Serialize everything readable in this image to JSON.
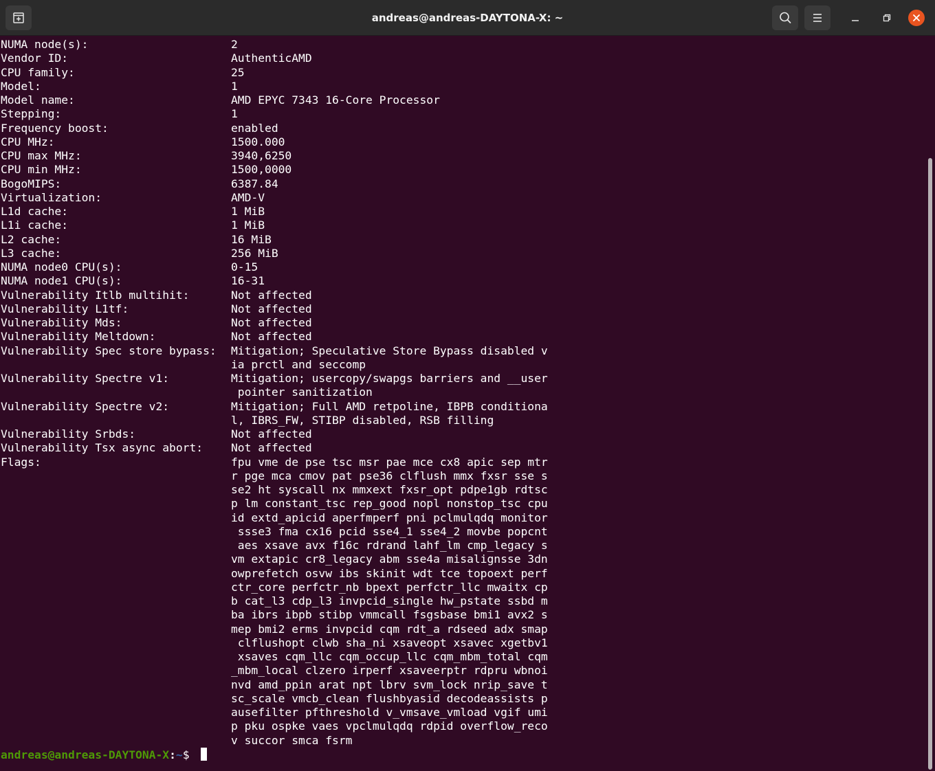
{
  "window": {
    "title": "andreas@andreas-DAYTONA-X: ~"
  },
  "icons": {
    "new_tab": "new-tab-icon",
    "search": "search-icon",
    "menu": "hamburger-menu-icon",
    "minimize": "minimize-icon",
    "maximize": "maximize-icon",
    "close": "close-icon"
  },
  "colors": {
    "terminal_bg": "#300a24",
    "titlebar_bg": "#2b2b2b",
    "close_btn": "#e95420",
    "prompt_user": "#4e9a06",
    "prompt_path": "#3465a4"
  },
  "terminal": {
    "lines": [
      {
        "label": "NUMA node(s):",
        "value": "2"
      },
      {
        "label": "Vendor ID:",
        "value": "AuthenticAMD"
      },
      {
        "label": "CPU family:",
        "value": "25"
      },
      {
        "label": "Model:",
        "value": "1"
      },
      {
        "label": "Model name:",
        "value": "AMD EPYC 7343 16-Core Processor"
      },
      {
        "label": "Stepping:",
        "value": "1"
      },
      {
        "label": "Frequency boost:",
        "value": "enabled"
      },
      {
        "label": "CPU MHz:",
        "value": "1500.000"
      },
      {
        "label": "CPU max MHz:",
        "value": "3940,6250"
      },
      {
        "label": "CPU min MHz:",
        "value": "1500,0000"
      },
      {
        "label": "BogoMIPS:",
        "value": "6387.84"
      },
      {
        "label": "Virtualization:",
        "value": "AMD-V"
      },
      {
        "label": "L1d cache:",
        "value": "1 MiB"
      },
      {
        "label": "L1i cache:",
        "value": "1 MiB"
      },
      {
        "label": "L2 cache:",
        "value": "16 MiB"
      },
      {
        "label": "L3 cache:",
        "value": "256 MiB"
      },
      {
        "label": "NUMA node0 CPU(s):",
        "value": "0-15"
      },
      {
        "label": "NUMA node1 CPU(s):",
        "value": "16-31"
      },
      {
        "label": "Vulnerability Itlb multihit:",
        "value": "Not affected"
      },
      {
        "label": "Vulnerability L1tf:",
        "value": "Not affected"
      },
      {
        "label": "Vulnerability Mds:",
        "value": "Not affected"
      },
      {
        "label": "Vulnerability Meltdown:",
        "value": "Not affected"
      },
      {
        "label": "Vulnerability Spec store bypass:",
        "value": "Mitigation; Speculative Store Bypass disabled v"
      },
      {
        "label": "",
        "value": "ia prctl and seccomp"
      },
      {
        "label": "Vulnerability Spectre v1:",
        "value": "Mitigation; usercopy/swapgs barriers and __user"
      },
      {
        "label": "",
        "value": " pointer sanitization"
      },
      {
        "label": "Vulnerability Spectre v2:",
        "value": "Mitigation; Full AMD retpoline, IBPB conditiona"
      },
      {
        "label": "",
        "value": "l, IBRS_FW, STIBP disabled, RSB filling"
      },
      {
        "label": "Vulnerability Srbds:",
        "value": "Not affected"
      },
      {
        "label": "Vulnerability Tsx async abort:",
        "value": "Not affected"
      },
      {
        "label": "Flags:",
        "value": "fpu vme de pse tsc msr pae mce cx8 apic sep mtr"
      },
      {
        "label": "",
        "value": "r pge mca cmov pat pse36 clflush mmx fxsr sse s"
      },
      {
        "label": "",
        "value": "se2 ht syscall nx mmxext fxsr_opt pdpe1gb rdtsc"
      },
      {
        "label": "",
        "value": "p lm constant_tsc rep_good nopl nonstop_tsc cpu"
      },
      {
        "label": "",
        "value": "id extd_apicid aperfmperf pni pclmulqdq monitor"
      },
      {
        "label": "",
        "value": " ssse3 fma cx16 pcid sse4_1 sse4_2 movbe popcnt"
      },
      {
        "label": "",
        "value": " aes xsave avx f16c rdrand lahf_lm cmp_legacy s"
      },
      {
        "label": "",
        "value": "vm extapic cr8_legacy abm sse4a misalignsse 3dn"
      },
      {
        "label": "",
        "value": "owprefetch osvw ibs skinit wdt tce topoext perf"
      },
      {
        "label": "",
        "value": "ctr_core perfctr_nb bpext perfctr_llc mwaitx cp"
      },
      {
        "label": "",
        "value": "b cat_l3 cdp_l3 invpcid_single hw_pstate ssbd m"
      },
      {
        "label": "",
        "value": "ba ibrs ibpb stibp vmmcall fsgsbase bmi1 avx2 s"
      },
      {
        "label": "",
        "value": "mep bmi2 erms invpcid cqm rdt_a rdseed adx smap"
      },
      {
        "label": "",
        "value": " clflushopt clwb sha_ni xsaveopt xsavec xgetbv1"
      },
      {
        "label": "",
        "value": " xsaves cqm_llc cqm_occup_llc cqm_mbm_total cqm"
      },
      {
        "label": "",
        "value": "_mbm_local clzero irperf xsaveerptr rdpru wbnoi"
      },
      {
        "label": "",
        "value": "nvd amd_ppin arat npt lbrv svm_lock nrip_save t"
      },
      {
        "label": "",
        "value": "sc_scale vmcb_clean flushbyasid decodeassists p"
      },
      {
        "label": "",
        "value": "ausefilter pfthreshold v_vmsave_vmload vgif umi"
      },
      {
        "label": "",
        "value": "p pku ospke vaes vpclmulqdq rdpid overflow_reco"
      },
      {
        "label": "",
        "value": "v succor smca fsrm"
      }
    ],
    "prompt": {
      "user_host": "andreas@andreas-DAYTONA-X",
      "separator": ":",
      "path": "~",
      "symbol": "$ "
    }
  }
}
